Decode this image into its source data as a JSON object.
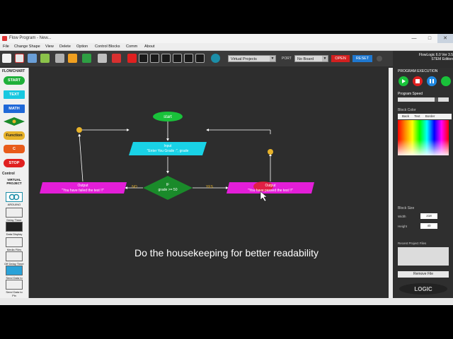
{
  "window": {
    "title": "Flow Program - New..."
  },
  "menu": [
    "File",
    "Change Shape",
    "View",
    "Delete",
    "Option",
    "Control Blocks",
    "Comm",
    "About"
  ],
  "toolbar": {
    "project_select": "Virtual Projects",
    "port_label": "PORT",
    "port_select": "No Board",
    "open_label": "OPEN",
    "reset_label": "RESET"
  },
  "version": {
    "line1": "FlowLogic 6.0 Ver 3.5",
    "line2": "STEM Edition"
  },
  "palette": {
    "header": "FLOWCHART",
    "start": "START",
    "text": "TEXT",
    "math": "MATH",
    "function": "Function",
    "c_label": "C",
    "stop": "STOP",
    "control_header": "Control",
    "virtual_project": "VIRTUAL PROJECT",
    "arduino": "ARDUINO",
    "items": [
      "Delay Timer",
      "Data Display",
      "Media Files",
      "Off Delay Timer",
      "Send Data to Cloud",
      "Send Data to Pin"
    ]
  },
  "flow": {
    "start": "start",
    "input_line1": "Input",
    "input_line2": "\"Enter You Grade :\", grade",
    "if_line1": "IF",
    "if_line2": "grade >= 50",
    "no_label": "NO",
    "yes_label": "YES",
    "fail_line1": "Output",
    "fail_line2": "\"You have failed the test !!\"",
    "pass_line1": "Output",
    "pass_line2": "\"You have passed the test !!\""
  },
  "right_panel": {
    "execution_title": "PROGRAM EXECUTION",
    "speed_title": "Program Speed",
    "color_title": "Block Color",
    "color_opts": [
      "Back",
      "Text",
      "Border"
    ],
    "size_title": "Block Size",
    "width_label": "Width",
    "width_value": "218",
    "height_label": "Height",
    "height_value": "40",
    "recent_title": "Recent Project Files",
    "remove_label": "Remove File"
  },
  "caption": "Do the housekeeping for better readability",
  "colors": {
    "start": "#19c23a",
    "io": "#19d2e6",
    "decision": "#1a8a2a",
    "output": "#e31ed8",
    "connector": "#e7b22a",
    "stop": "#e02020",
    "canvas": "#2d2d2d"
  }
}
